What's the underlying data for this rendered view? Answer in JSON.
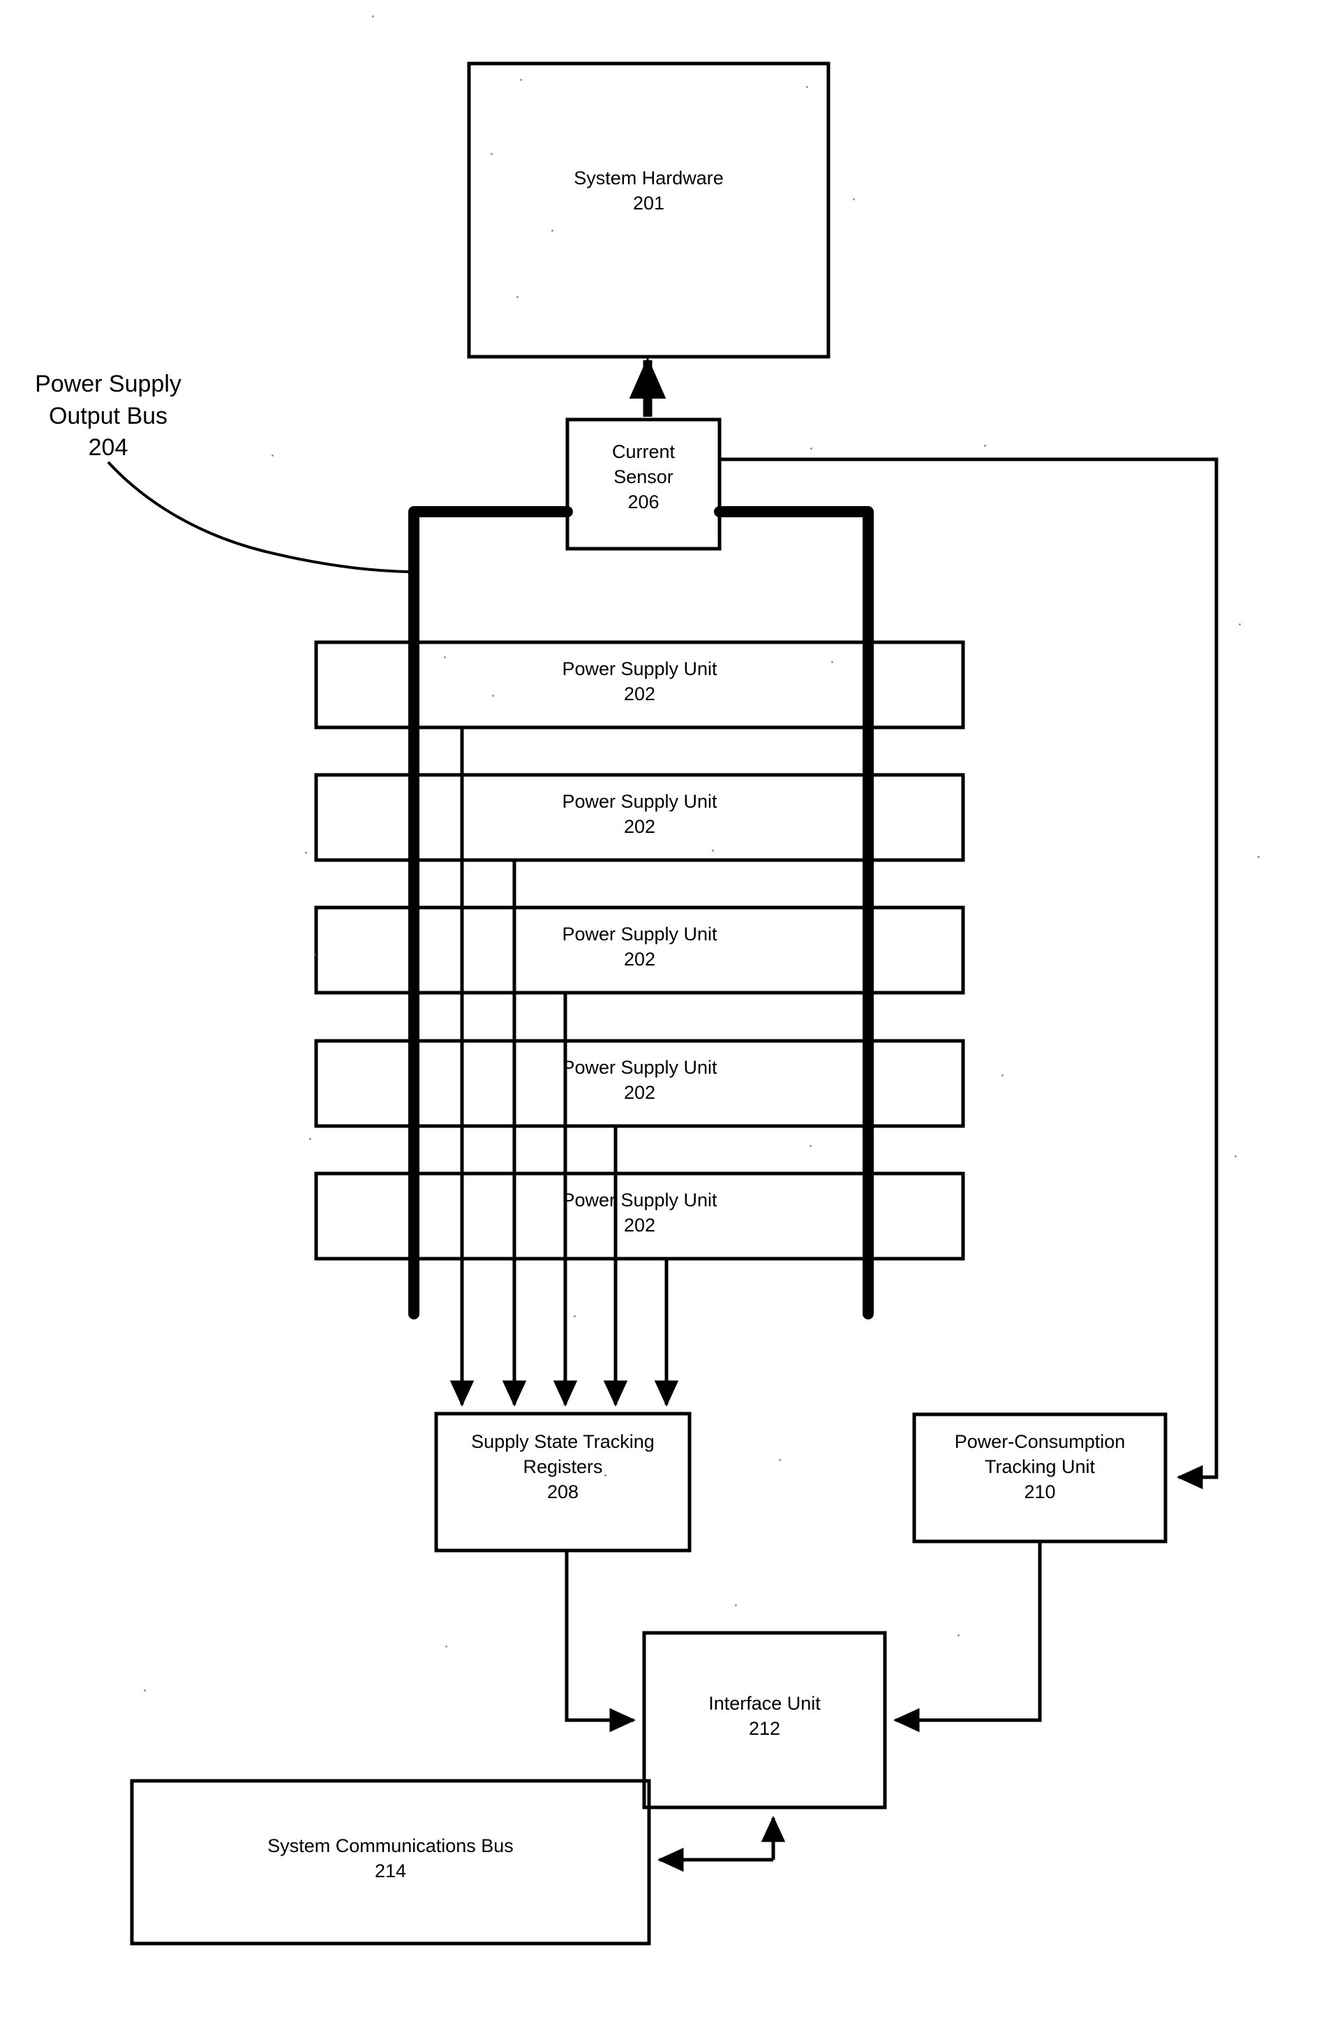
{
  "figure": {
    "type": "patent-block-diagram",
    "background_color": "#ffffff",
    "line_color": "#000000"
  },
  "callouts": [
    {
      "id": "power-supply-output-bus",
      "text": "Power Supply\nOutput Bus\n204",
      "lines": [
        "Power Supply",
        "Output Bus",
        "204"
      ],
      "reference_numeral": "204"
    }
  ],
  "blocks": [
    {
      "id": "system-hardware",
      "title": "System Hardware",
      "reference_numeral": "201",
      "text": "System Hardware\n201"
    },
    {
      "id": "current-sensor",
      "title": "Current Sensor",
      "reference_numeral": "206",
      "text": "Current\nSensor\n206"
    },
    {
      "id": "power-supply-unit-1",
      "title": "Power Supply Unit",
      "reference_numeral": "202",
      "text": "Power Supply Unit\n202"
    },
    {
      "id": "power-supply-unit-2",
      "title": "Power Supply Unit",
      "reference_numeral": "202",
      "text": "Power Supply Unit\n202"
    },
    {
      "id": "power-supply-unit-3",
      "title": "Power Supply Unit",
      "reference_numeral": "202",
      "text": "Power Supply Unit\n202"
    },
    {
      "id": "power-supply-unit-4",
      "title": "Power Supply Unit",
      "reference_numeral": "202",
      "text": "Power Supply Unit\n202"
    },
    {
      "id": "power-supply-unit-5",
      "title": "Power Supply Unit",
      "reference_numeral": "202",
      "text": "Power Supply Unit\n202"
    },
    {
      "id": "supply-state-tracking-registers",
      "title": "Supply State Tracking Registers",
      "reference_numeral": "208",
      "text": "Supply State Tracking\nRegisters\n208"
    },
    {
      "id": "power-consumption-tracking-unit",
      "title": "Power-Consumption Tracking Unit",
      "reference_numeral": "210",
      "text": "Power-Consumption\nTracking Unit\n210"
    },
    {
      "id": "interface-unit",
      "title": "Interface Unit",
      "reference_numeral": "212",
      "text": "Interface Unit\n212"
    },
    {
      "id": "system-communications-bus",
      "title": "System Communications Bus",
      "reference_numeral": "214",
      "text": "System Communications Bus\n214"
    }
  ],
  "connections": [
    {
      "id": "sensor-to-hardware",
      "from": "current-sensor",
      "to": "system-hardware",
      "style": "thick",
      "arrow": "single"
    },
    {
      "id": "bus-left-riser",
      "from": "power-supply-output-bus",
      "to": "current-sensor",
      "style": "thick",
      "arrow": "none"
    },
    {
      "id": "bus-right-riser",
      "from": "current-sensor",
      "to": "power-supply-output-bus",
      "style": "thick",
      "arrow": "none"
    },
    {
      "id": "sensor-to-power-consumption-tracking-unit",
      "from": "current-sensor",
      "to": "power-consumption-tracking-unit",
      "style": "thin",
      "arrow": "single"
    },
    {
      "id": "psu1-to-registers",
      "from": "power-supply-unit-1",
      "to": "supply-state-tracking-registers",
      "style": "thin",
      "arrow": "single"
    },
    {
      "id": "psu2-to-registers",
      "from": "power-supply-unit-2",
      "to": "supply-state-tracking-registers",
      "style": "thin",
      "arrow": "single"
    },
    {
      "id": "psu3-to-registers",
      "from": "power-supply-unit-3",
      "to": "supply-state-tracking-registers",
      "style": "thin",
      "arrow": "single"
    },
    {
      "id": "psu4-to-registers",
      "from": "power-supply-unit-4",
      "to": "supply-state-tracking-registers",
      "style": "thin",
      "arrow": "single"
    },
    {
      "id": "psu5-to-registers",
      "from": "power-supply-unit-5",
      "to": "supply-state-tracking-registers",
      "style": "thin",
      "arrow": "single"
    },
    {
      "id": "registers-to-interface-unit",
      "from": "supply-state-tracking-registers",
      "to": "interface-unit",
      "style": "thin",
      "arrow": "single"
    },
    {
      "id": "power-consumption-tracking-unit-to-interface-unit",
      "from": "power-consumption-tracking-unit",
      "to": "interface-unit",
      "style": "thin",
      "arrow": "single"
    },
    {
      "id": "interface-unit-to-system-communications-bus",
      "from": "interface-unit",
      "to": "system-communications-bus",
      "style": "thin",
      "arrow": "double"
    }
  ]
}
